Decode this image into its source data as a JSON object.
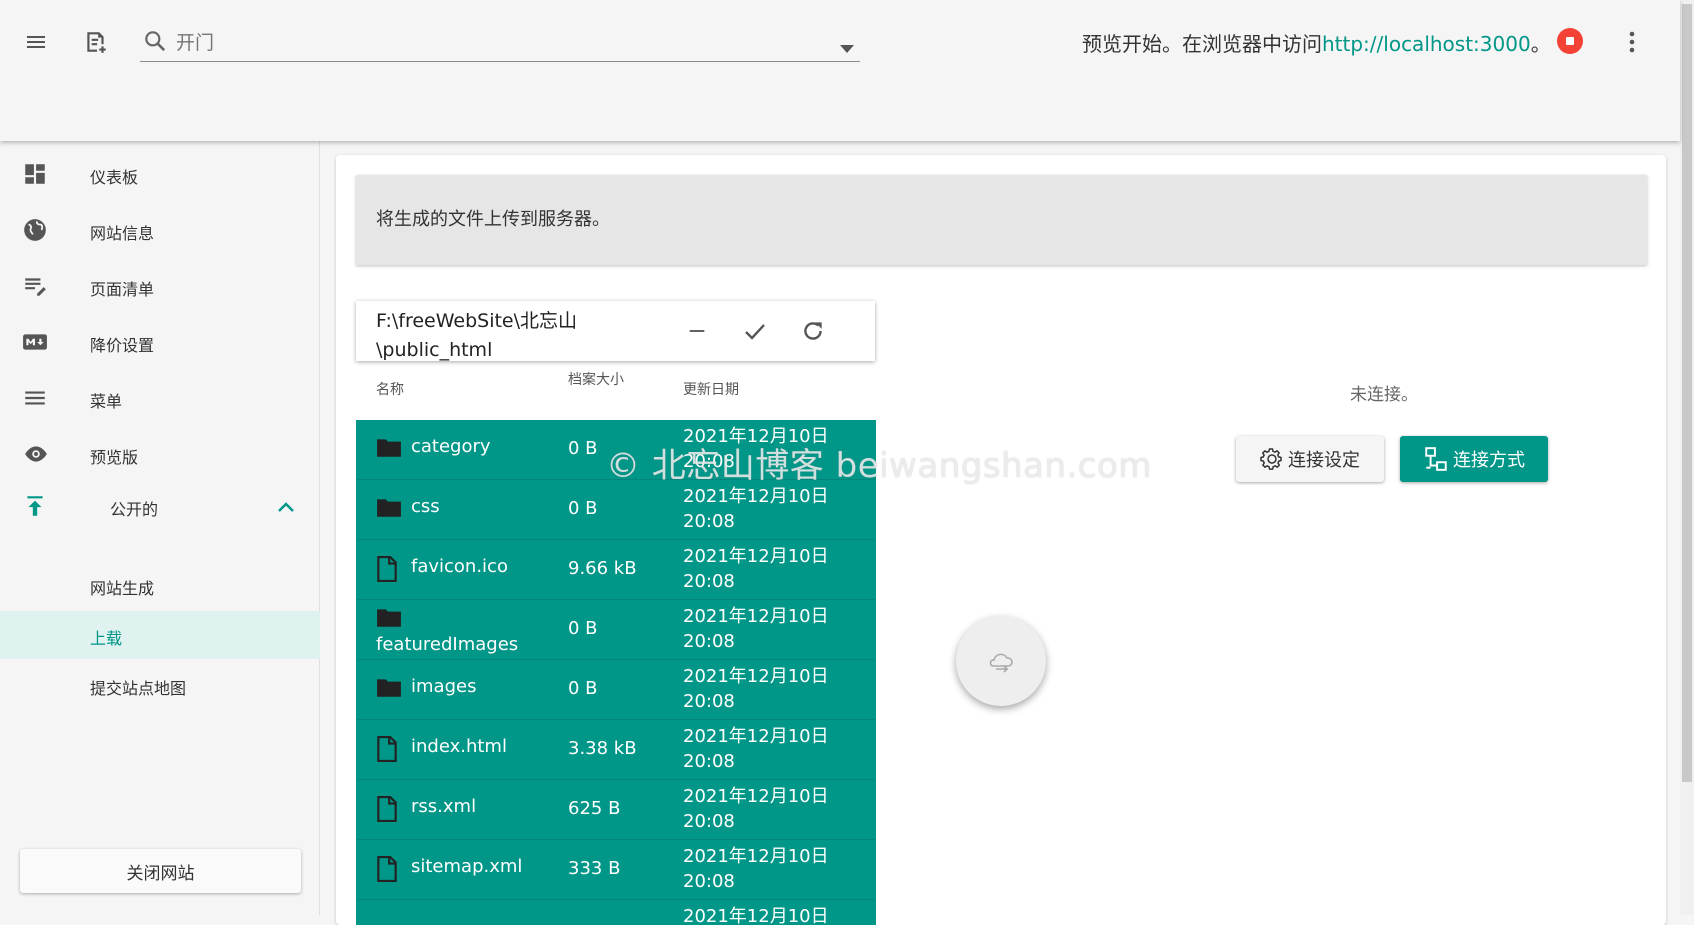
{
  "topbar": {
    "search_placeholder": "开门",
    "preview_text": "预览开始。在浏览器中访问",
    "preview_url": "http://localhost:3000",
    "preview_suffix": "。"
  },
  "sidebar": {
    "items": [
      {
        "label": "仪表板",
        "icon": "dashboard-icon"
      },
      {
        "label": "网站信息",
        "icon": "globe-icon"
      },
      {
        "label": "页面清单",
        "icon": "edit-list-icon"
      },
      {
        "label": "降价设置",
        "icon": "markdown-icon"
      },
      {
        "label": "菜单",
        "icon": "menu-icon"
      },
      {
        "label": "预览版",
        "icon": "eye-icon"
      }
    ],
    "publish_group": {
      "label": "公开的",
      "icon": "publish-icon",
      "expanded": true
    },
    "sub_items": [
      {
        "label": "网站生成",
        "active": false
      },
      {
        "label": "上载",
        "active": true
      },
      {
        "label": "提交站点地图",
        "active": false
      }
    ],
    "close_button": "关闭网站"
  },
  "main": {
    "info": "将生成的文件上传到服务器。",
    "path": "F:\\freeWebSite\\北忘山\\public_html",
    "columns": {
      "name": "名称",
      "size": "档案大小",
      "date": "更新日期"
    },
    "files": [
      {
        "name": "category",
        "type": "folder",
        "size": "0 B",
        "date": "2021年12月10日",
        "time": "20:08"
      },
      {
        "name": "css",
        "type": "folder",
        "size": "0 B",
        "date": "2021年12月10日",
        "time": "20:08"
      },
      {
        "name": "favicon.ico",
        "type": "file",
        "size": "9.66 kB",
        "date": "2021年12月10日",
        "time": "20:08"
      },
      {
        "name": "featuredImages",
        "type": "folder",
        "size": "0 B",
        "date": "2021年12月10日",
        "time": "20:08"
      },
      {
        "name": "images",
        "type": "folder",
        "size": "0 B",
        "date": "2021年12月10日",
        "time": "20:08"
      },
      {
        "name": "index.html",
        "type": "file",
        "size": "3.38 kB",
        "date": "2021年12月10日",
        "time": "20:08"
      },
      {
        "name": "rss.xml",
        "type": "file",
        "size": "625 B",
        "date": "2021年12月10日",
        "time": "20:08"
      },
      {
        "name": "sitemap.xml",
        "type": "file",
        "size": "333 B",
        "date": "2021年12月10日",
        "time": "20:08"
      },
      {
        "name": "",
        "type": "file",
        "size": "",
        "date": "2021年12月10日",
        "time": ""
      }
    ],
    "connection_status": "未连接。",
    "conn_settings_label": "连接设定",
    "conn_method_label": "连接方式",
    "watermark": "© 北忘山博客 beiwangshan.com"
  },
  "colors": {
    "accent": "#009688",
    "stop": "#f44336",
    "active_bg": "#dff2ef"
  }
}
